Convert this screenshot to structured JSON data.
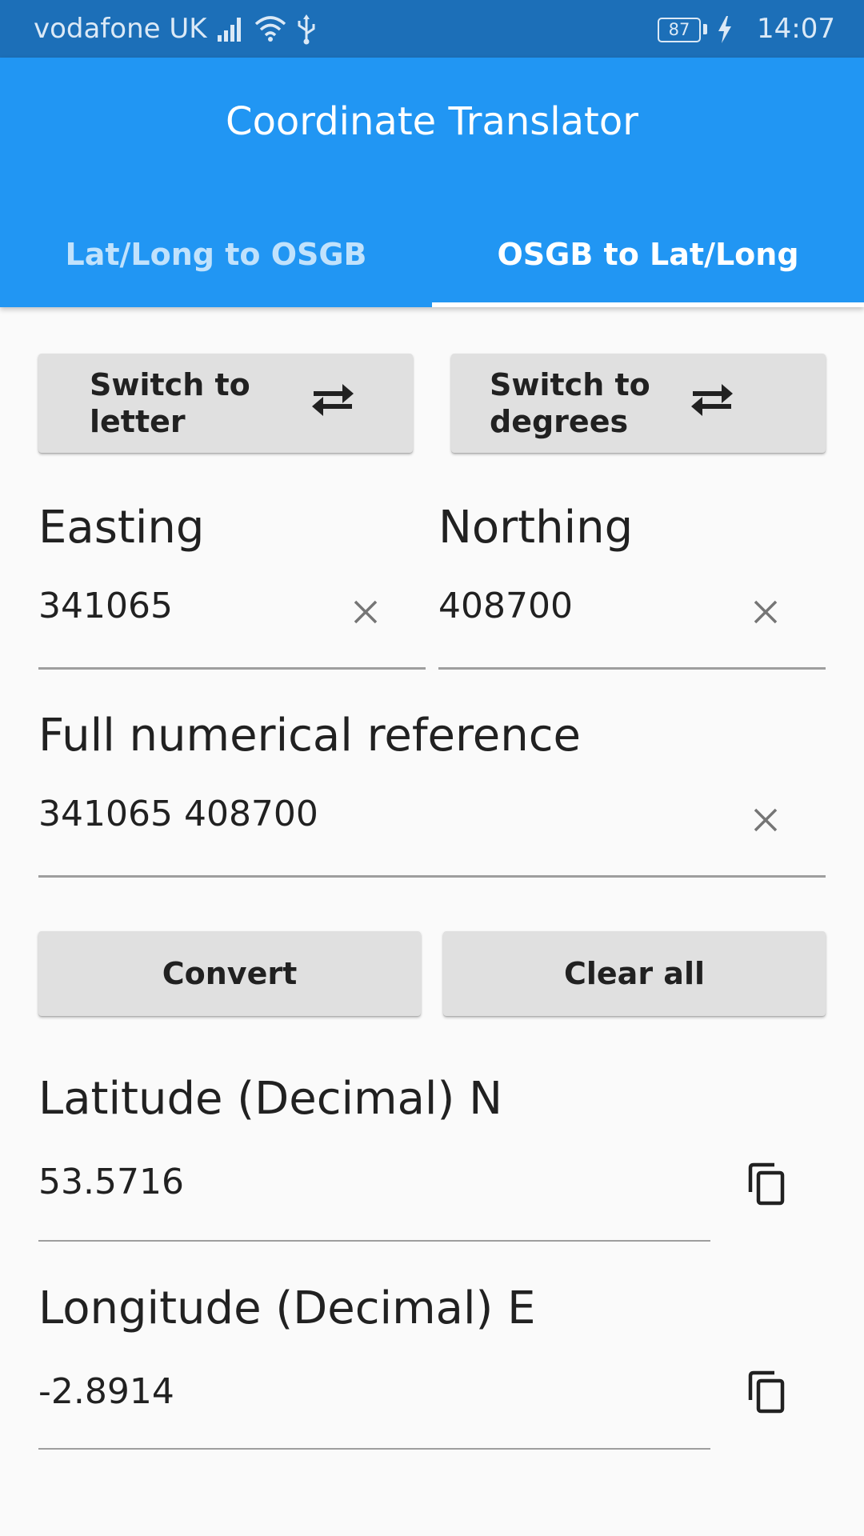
{
  "status_bar": {
    "carrier": "vodafone UK",
    "battery": "87",
    "time": "14:07",
    "icons": [
      "signal-icon",
      "wifi-icon",
      "usb-icon",
      "battery-icon",
      "charging-icon"
    ]
  },
  "app": {
    "title": "Coordinate Translator",
    "primary_color": "#2196f3",
    "status_bar_color": "#1c6fb8"
  },
  "tabs": [
    {
      "label": "Lat/Long to OSGB",
      "selected": false
    },
    {
      "label": "OSGB to Lat/Long",
      "selected": true
    }
  ],
  "switch_buttons": {
    "letter": {
      "label": "Switch to letter",
      "icon": "swap-horiz-icon"
    },
    "degrees": {
      "label": "Switch to degrees",
      "icon": "swap-horiz-icon"
    }
  },
  "fields": {
    "easting": {
      "label": "Easting",
      "value": "341065",
      "clear_icon": "close-icon"
    },
    "northing": {
      "label": "Northing",
      "value": "408700",
      "clear_icon": "close-icon"
    },
    "full_reference": {
      "label": "Full numerical reference",
      "value": "341065 408700",
      "clear_icon": "close-icon"
    }
  },
  "actions": {
    "convert_label": "Convert",
    "clear_all_label": "Clear all"
  },
  "results": {
    "latitude": {
      "label": "Latitude (Decimal) N",
      "value": "53.5716",
      "copy_icon": "copy-icon"
    },
    "longitude": {
      "label": "Longitude (Decimal) E",
      "value": "-2.8914",
      "copy_icon": "copy-icon"
    }
  }
}
